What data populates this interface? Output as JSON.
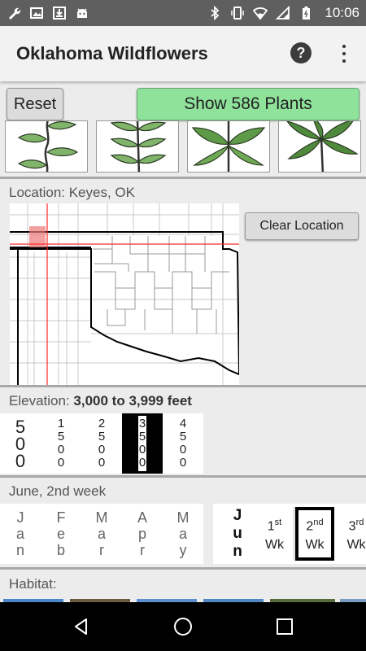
{
  "status_bar": {
    "time": "10:06",
    "left_icons": [
      "wrench-icon",
      "image-icon",
      "download-icon",
      "android-icon"
    ],
    "right_icons": [
      "bluetooth-icon",
      "vibrate-icon",
      "wifi-icon",
      "signal-icon",
      "battery-icon"
    ]
  },
  "app_bar": {
    "title": "Oklahoma Wildflowers",
    "help_label": "?",
    "menu_icon": "overflow-menu-icon"
  },
  "actions": {
    "reset_label": "Reset",
    "show_label": "Show 586 Plants",
    "show_color": "#8ee29a"
  },
  "leaf_types": [
    "alternate-leaves-icon",
    "opposite-leaves-icon",
    "whorled-leaves-icon",
    "palmate-leaves-icon"
  ],
  "location": {
    "label": "Location: Keyes, OK",
    "clear_label": "Clear Location",
    "marker_color": "#ff0000"
  },
  "elevation": {
    "label_prefix": "Elevation:",
    "label_value": "3,000 to 3,999 feet",
    "options": [
      {
        "digits": [
          "5",
          "0",
          "0"
        ]
      },
      {
        "digits": [
          "1",
          "5",
          "0",
          "0"
        ]
      },
      {
        "digits": [
          "2",
          "5",
          "0",
          "0"
        ]
      },
      {
        "digits": [
          "3",
          "5",
          "0",
          "0"
        ]
      },
      {
        "digits": [
          "4",
          "5",
          "0",
          "0"
        ]
      }
    ],
    "selected_index": 3
  },
  "date": {
    "label": "June, 2nd week",
    "months": [
      {
        "letters": [
          "J",
          "a",
          "n"
        ]
      },
      {
        "letters": [
          "F",
          "e",
          "b"
        ]
      },
      {
        "letters": [
          "M",
          "a",
          "r"
        ]
      },
      {
        "letters": [
          "A",
          "p",
          "r"
        ]
      },
      {
        "letters": [
          "M",
          "a",
          "y"
        ]
      }
    ],
    "current_month": [
      "J",
      "u",
      "n"
    ],
    "weeks": [
      {
        "num": "1",
        "suffix": "st",
        "wk": "Wk"
      },
      {
        "num": "2",
        "suffix": "nd",
        "wk": "Wk"
      },
      {
        "num": "3",
        "suffix": "rd",
        "wk": "Wk"
      }
    ],
    "selected_week_index": 1
  },
  "habitat": {
    "label": "Habitat:"
  },
  "nav_bar": {
    "icons": [
      "back-icon",
      "home-icon",
      "recents-icon"
    ]
  }
}
